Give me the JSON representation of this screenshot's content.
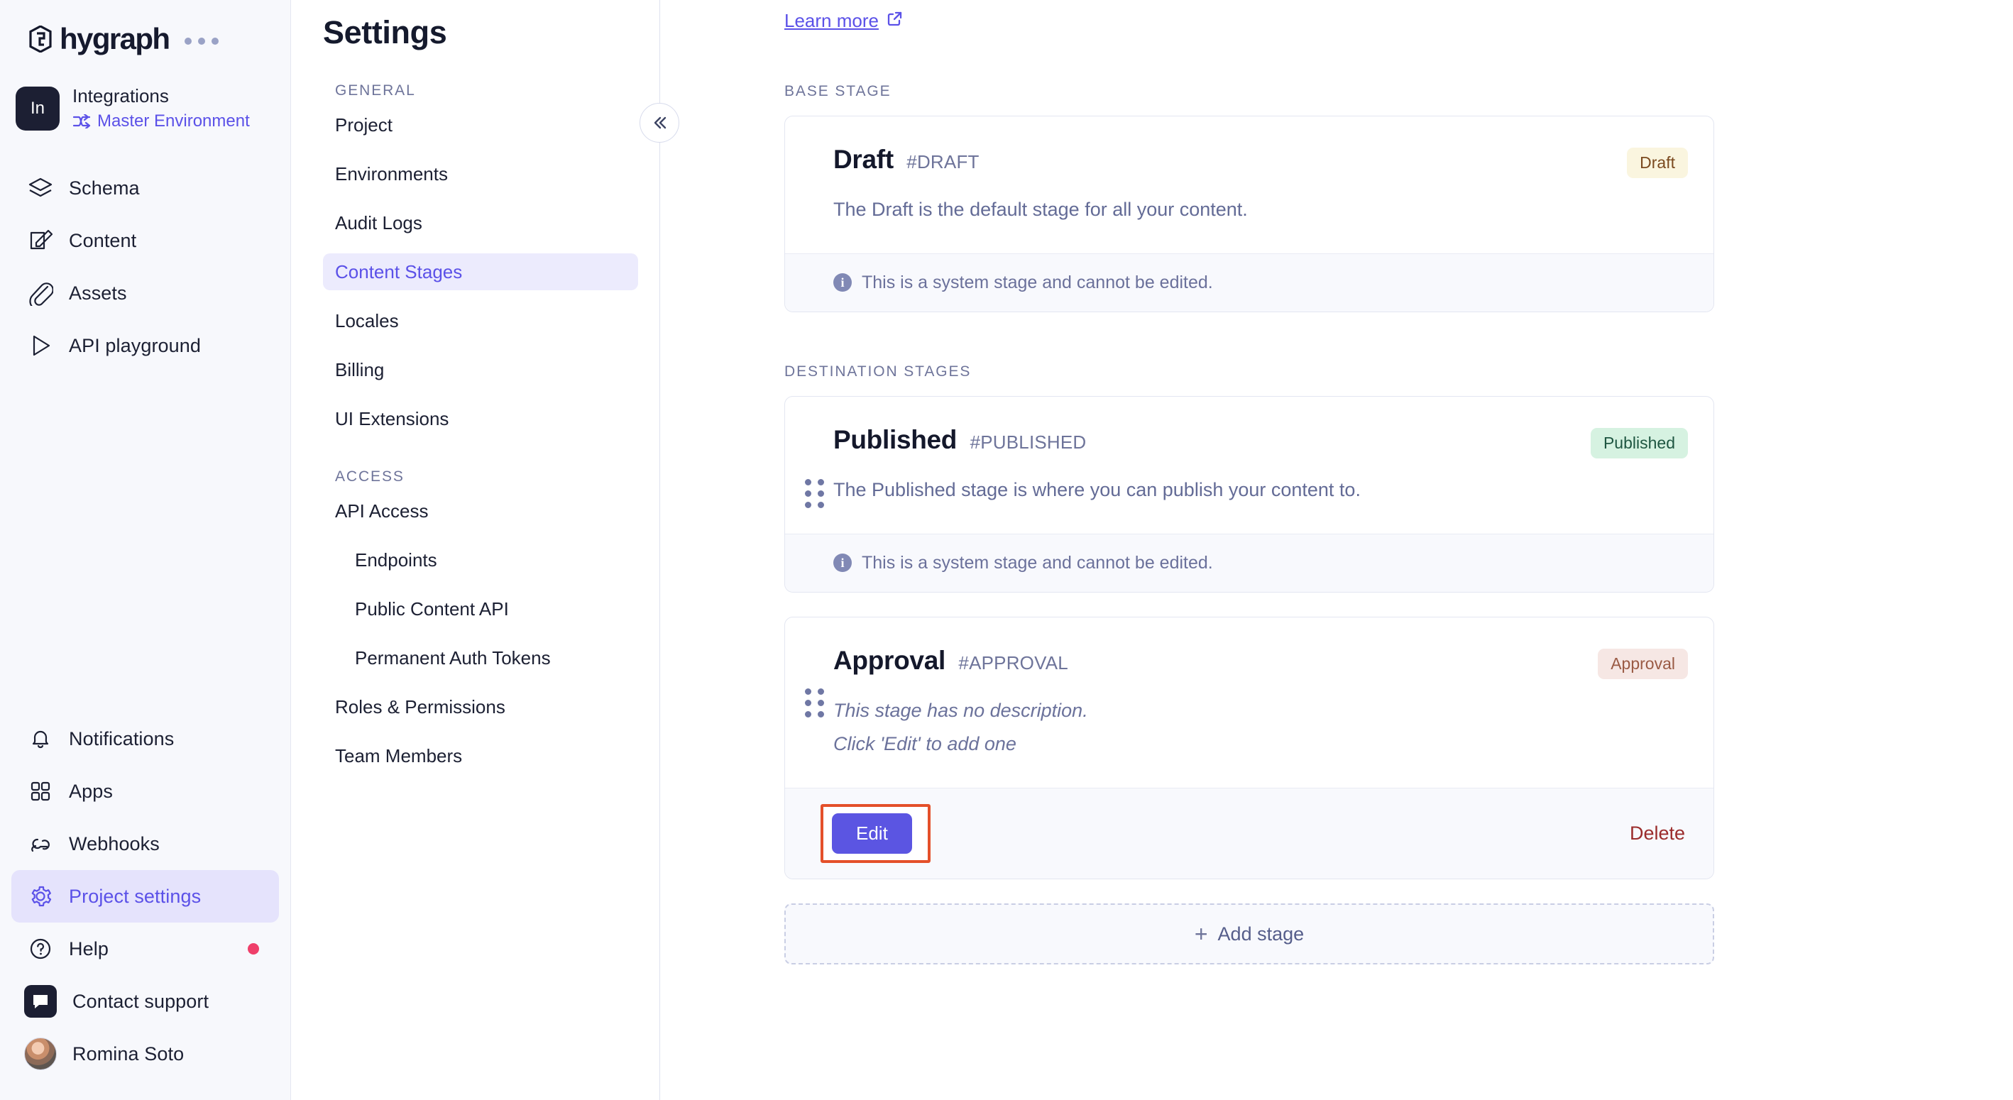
{
  "brand": {
    "name": "hygraph",
    "menu_icon": "ellipsis-icon"
  },
  "project": {
    "initials": "In",
    "name": "Integrations",
    "environment": "Master Environment",
    "environment_icon": "branch-icon"
  },
  "nav": {
    "primary": [
      {
        "label": "Schema",
        "icon": "layers-icon",
        "active": false
      },
      {
        "label": "Content",
        "icon": "edit-square-icon",
        "active": false
      },
      {
        "label": "Assets",
        "icon": "paperclip-icon",
        "active": false
      },
      {
        "label": "API playground",
        "icon": "play-icon",
        "active": false
      }
    ],
    "secondary": [
      {
        "label": "Notifications",
        "icon": "bell-icon",
        "active": false,
        "dot": false
      },
      {
        "label": "Apps",
        "icon": "grid-icon",
        "active": false,
        "dot": false
      },
      {
        "label": "Webhooks",
        "icon": "webhook-icon",
        "active": false,
        "dot": false
      },
      {
        "label": "Project settings",
        "icon": "gear-icon",
        "active": true,
        "dot": false
      },
      {
        "label": "Help",
        "icon": "question-circle-icon",
        "active": false,
        "dot": true
      },
      {
        "label": "Contact support",
        "icon": "chat-icon",
        "active": false,
        "dot": false
      },
      {
        "label": "Romina Soto",
        "icon": "avatar",
        "active": false,
        "dot": false
      }
    ]
  },
  "settings": {
    "title": "Settings",
    "collapse_icon": "chevron-double-left-icon",
    "groups": [
      {
        "label": "GENERAL",
        "items": [
          {
            "label": "Project",
            "active": false,
            "indent": false
          },
          {
            "label": "Environments",
            "active": false,
            "indent": false
          },
          {
            "label": "Audit Logs",
            "active": false,
            "indent": false
          },
          {
            "label": "Content Stages",
            "active": true,
            "indent": false
          },
          {
            "label": "Locales",
            "active": false,
            "indent": false
          },
          {
            "label": "Billing",
            "active": false,
            "indent": false
          },
          {
            "label": "UI Extensions",
            "active": false,
            "indent": false
          }
        ]
      },
      {
        "label": "ACCESS",
        "items": [
          {
            "label": "API Access",
            "active": false,
            "indent": false
          },
          {
            "label": "Endpoints",
            "active": false,
            "indent": true
          },
          {
            "label": "Public Content API",
            "active": false,
            "indent": true
          },
          {
            "label": "Permanent Auth Tokens",
            "active": false,
            "indent": true
          },
          {
            "label": "Roles & Permissions",
            "active": false,
            "indent": false
          },
          {
            "label": "Team Members",
            "active": false,
            "indent": false
          }
        ]
      }
    ]
  },
  "main": {
    "learn_more": "Learn more",
    "learn_more_icon": "external-link-icon",
    "base_stage_label": "BASE STAGE",
    "destination_stages_label": "DESTINATION STAGES",
    "system_note": "This is a system stage and cannot be edited.",
    "system_note_icon": "info-icon",
    "base_stage": {
      "name": "Draft",
      "api_id": "#DRAFT",
      "badge": "Draft",
      "badge_style": "draft",
      "description": "The Draft is the default stage for all your content.",
      "system": true,
      "draggable": false
    },
    "destination_stages": [
      {
        "name": "Published",
        "api_id": "#PUBLISHED",
        "badge": "Published",
        "badge_style": "published",
        "description": "The Published stage is where you can publish your content to.",
        "system": true,
        "draggable": true
      },
      {
        "name": "Approval",
        "api_id": "#APPROVAL",
        "badge": "Approval",
        "badge_style": "approval",
        "description_empty_line1": "This stage has no description.",
        "description_empty_line2": "Click 'Edit' to add one",
        "system": false,
        "draggable": true,
        "edit_label": "Edit",
        "delete_label": "Delete"
      }
    ],
    "add_stage_label": "Add stage",
    "add_stage_icon": "plus-icon"
  },
  "colors": {
    "accent": "#5B51E8",
    "highlight_box": "#E4502A",
    "delete": "#9B2C2C",
    "notification_dot": "#EF3F6A"
  }
}
